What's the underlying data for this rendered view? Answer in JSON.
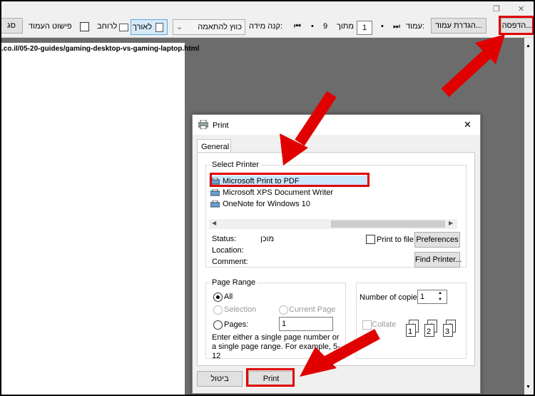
{
  "toolbar": {
    "print_button": "הדפסה...",
    "page_setup_button": "הגדרת עמוד...",
    "page_label": "עמוד:",
    "page_value": "1",
    "of_label": "מתוך",
    "of_total": "9",
    "scale_label": "קנה מידה:",
    "scale_value": "כווץ להתאמה",
    "portrait_label": "לאורך",
    "landscape_label": "לרוחב",
    "simplify_label": "פישוט העמוד",
    "cut_button": "סג",
    "nav_first": "⏮",
    "nav_prev": "•",
    "nav_next": "•",
    "nav_last": "⏭"
  },
  "preview": {
    "url_text": ".co.il/05-20-guides/gaming-desktop-vs-gaming-laptop.html"
  },
  "dialog": {
    "title": "Print",
    "close_glyph": "✕",
    "tab_general": "General",
    "select_printer_title": "Select Printer",
    "printers": [
      "Microsoft Print to PDF",
      "Microsoft XPS Document Writer",
      "OneNote for Windows 10"
    ],
    "status_label": "Status:",
    "status_value": "מוכן",
    "location_label": "Location:",
    "comment_label": "Comment:",
    "print_to_file_label": "Print to file",
    "preferences_button": "Preferences",
    "find_printer_button": "Find Printer...",
    "page_range_title": "Page Range",
    "range_all": "All",
    "range_selection": "Selection",
    "range_current_page": "Current Page",
    "range_pages": "Pages:",
    "pages_value": "1",
    "range_hint": "Enter either a single page number or a single page range.  For example, 5-12",
    "copies_label": "Number of copies:",
    "copies_value": "1",
    "collate_label": "Collate",
    "collate_pages": [
      "1",
      "1",
      "2",
      "2",
      "3",
      "3"
    ],
    "print_button": "Print",
    "cancel_button": "ביטול"
  },
  "colors": {
    "annotation": "#e00000",
    "selection": "#cce8ff",
    "preview_bg": "#6c6c6c"
  }
}
